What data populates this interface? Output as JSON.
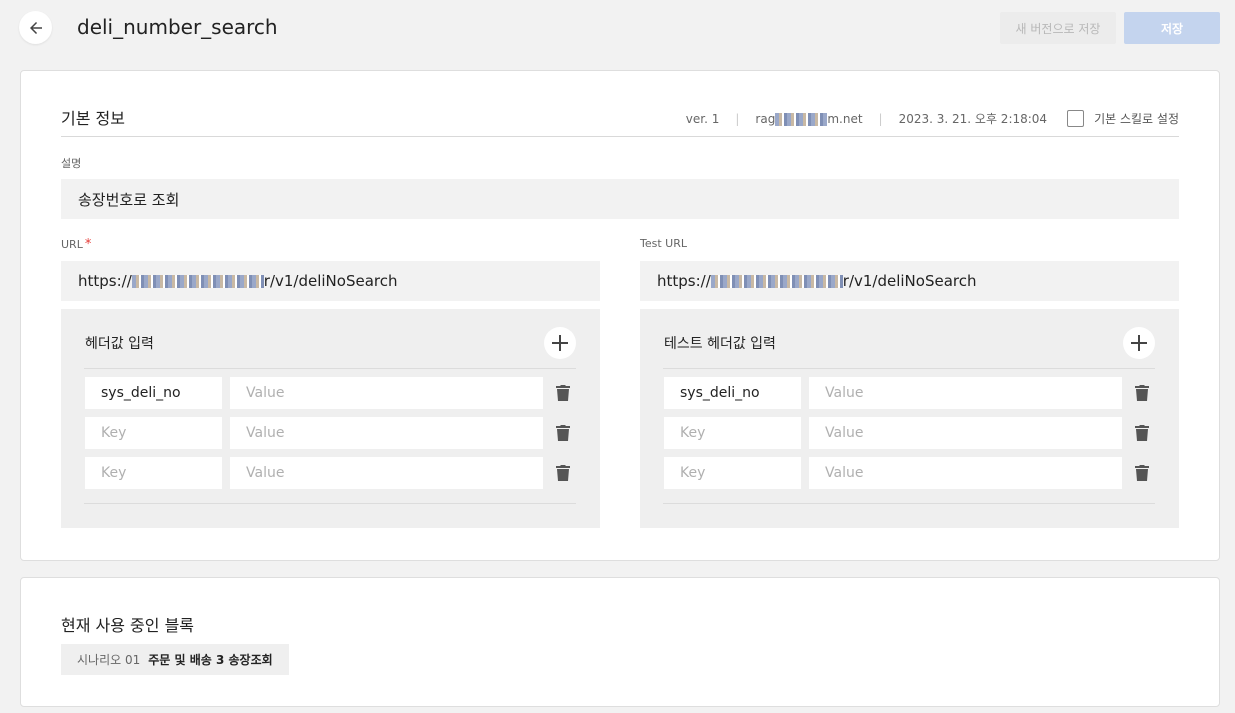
{
  "header": {
    "title": "deli_number_search",
    "save_new_label": "새 버전으로 저장",
    "save_label": "저장"
  },
  "basic_info": {
    "title": "기본 정보",
    "version": "ver. 1",
    "author_prefix": "rag",
    "author_suffix": "m.net",
    "timestamp": "2023. 3. 21. 오후 2:18:04",
    "default_skill_label": "기본 스킬로 설정",
    "default_skill_checked": false,
    "description_label": "설명",
    "description_value": "송장번호로 조회",
    "url_label": "URL",
    "url_required_mark": "*",
    "url_prefix": "https://",
    "url_suffix": "r/v1/deliNoSearch",
    "test_url_label": "Test URL",
    "test_url_prefix": "https://",
    "test_url_suffix": "r/v1/deliNoSearch"
  },
  "headers_panel": {
    "title": "헤더값 입력",
    "rows": [
      {
        "key": "sys_deli_no",
        "value": ""
      },
      {
        "key": "",
        "value": ""
      },
      {
        "key": "",
        "value": ""
      }
    ],
    "key_placeholder": "Key",
    "value_placeholder": "Value"
  },
  "test_headers_panel": {
    "title": "테스트 헤더값 입력",
    "rows": [
      {
        "key": "sys_deli_no",
        "value": ""
      },
      {
        "key": "",
        "value": ""
      },
      {
        "key": "",
        "value": ""
      }
    ],
    "key_placeholder": "Key",
    "value_placeholder": "Value"
  },
  "blocks": {
    "title": "현재 사용 중인 블록",
    "items": [
      {
        "scenario": "시나리오 01",
        "name": "주문 및 배송 3 송장조회"
      }
    ]
  },
  "icons": {
    "back": "arrow-left-icon",
    "add": "plus-icon",
    "delete": "trash-icon"
  },
  "colors": {
    "primary_disabled": "#c4d4ee",
    "required": "#e53935",
    "field_bg": "#f2f2f2"
  }
}
